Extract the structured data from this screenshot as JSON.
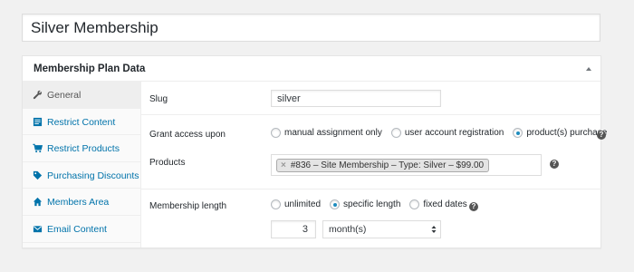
{
  "title": "Silver Membership",
  "metabox": {
    "title": "Membership Plan Data",
    "tabs": [
      {
        "label": "General",
        "icon": "wrench-icon",
        "active": true
      },
      {
        "label": "Restrict Content",
        "icon": "content-icon"
      },
      {
        "label": "Restrict Products",
        "icon": "cart-icon"
      },
      {
        "label": "Purchasing Discounts",
        "icon": "tag-icon"
      },
      {
        "label": "Members Area",
        "icon": "home-icon"
      },
      {
        "label": "Email Content",
        "icon": "email-icon"
      }
    ]
  },
  "general": {
    "slug_label": "Slug",
    "slug_value": "silver",
    "grant_label": "Grant access upon",
    "grant_options": [
      "manual assignment only",
      "user account registration",
      "product(s) purchase"
    ],
    "grant_selected": "product(s) purchase",
    "products_label": "Products",
    "product_chip": "#836 – Site Membership – Type: Silver – $99.00",
    "product_remove": "×",
    "length_label": "Membership length",
    "length_options": [
      "unlimited",
      "specific length",
      "fixed dates"
    ],
    "length_selected": "specific length",
    "length_value": "3",
    "length_unit": "month(s)",
    "help_glyph": "?"
  },
  "colors": {
    "link": "#0073aa",
    "radio_checked": "#1e8cbe"
  }
}
